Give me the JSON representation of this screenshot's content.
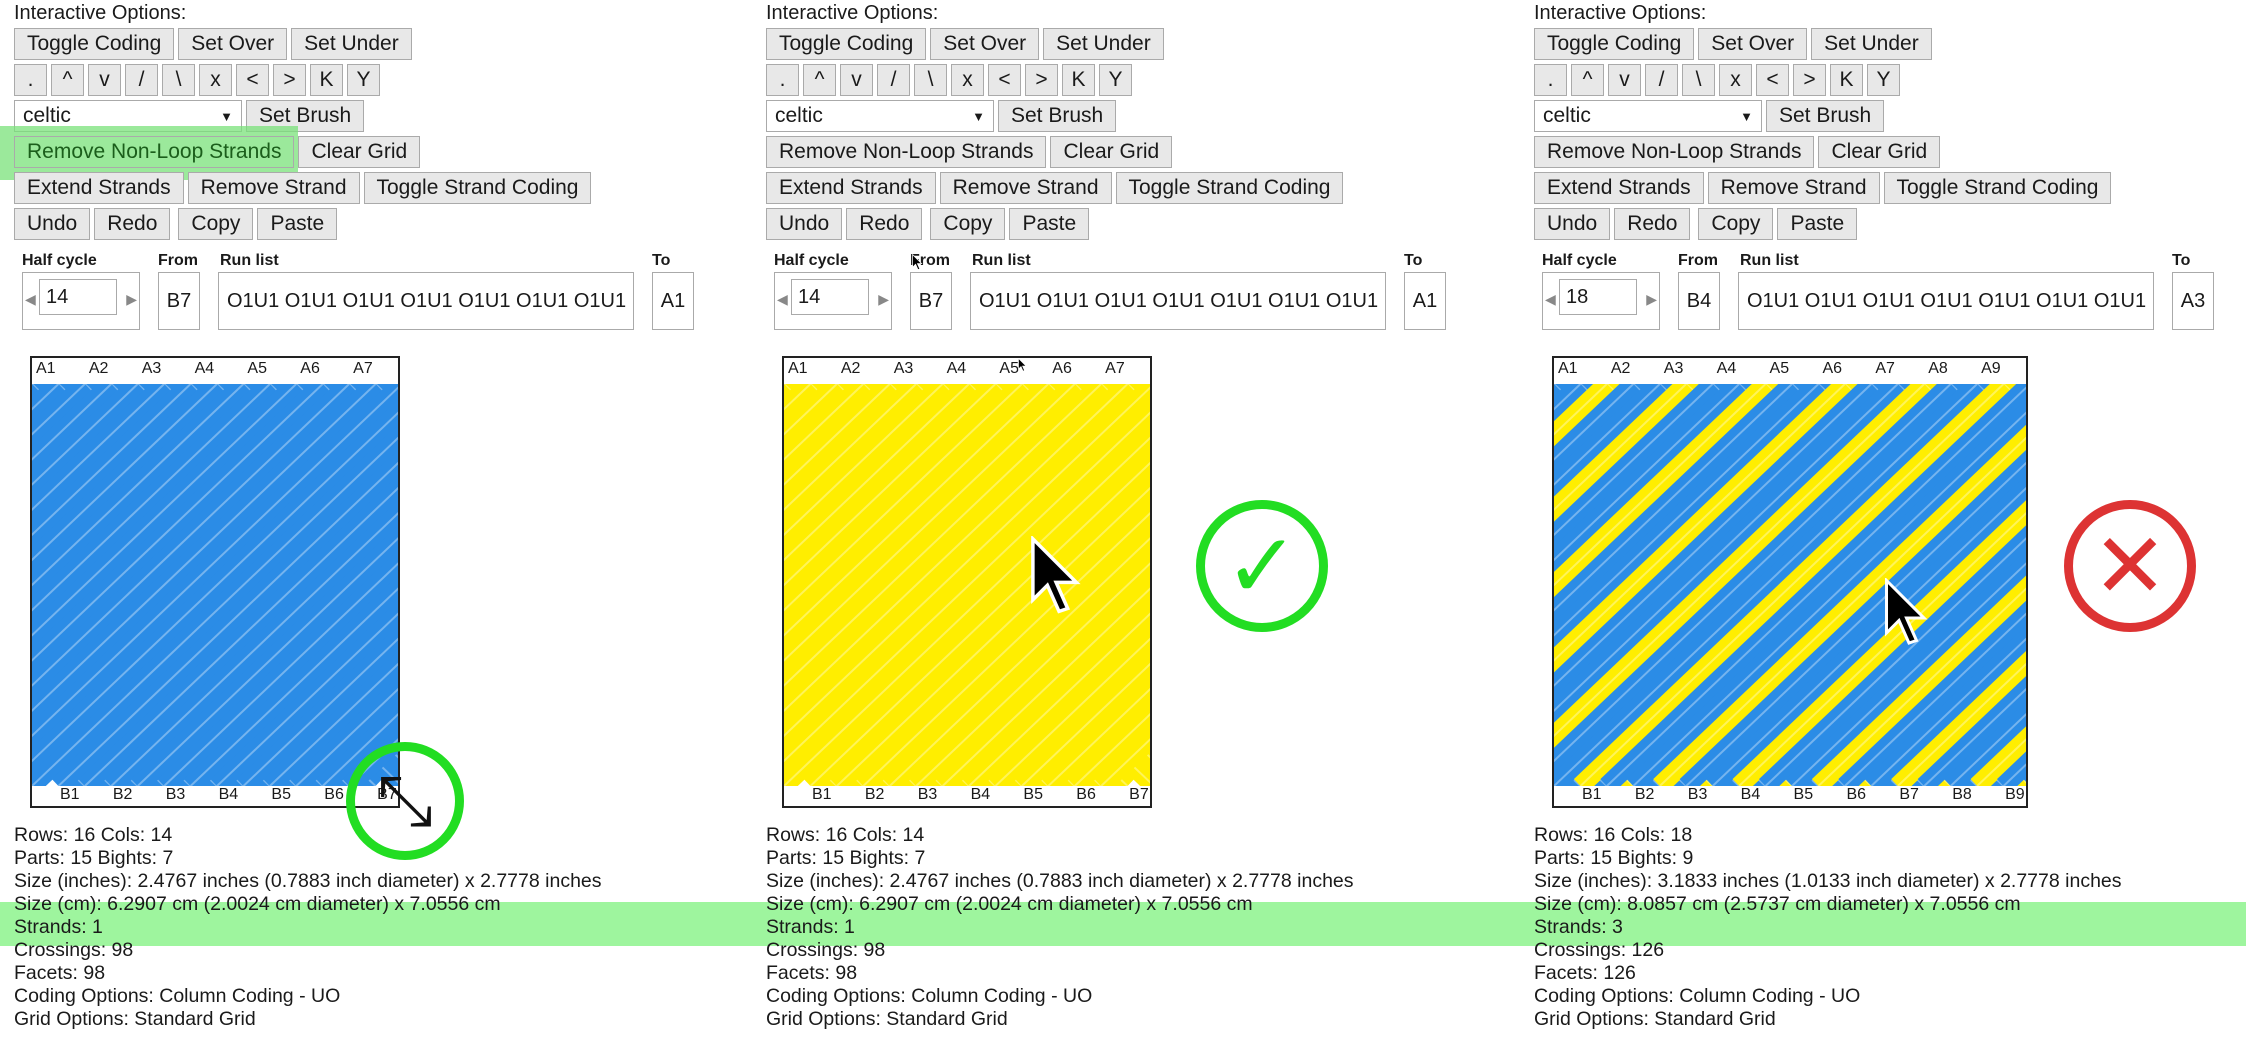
{
  "panels": [
    {
      "interactive_title": "Interactive Options:",
      "toolbar1": [
        "Toggle Coding",
        "Set Over",
        "Set Under"
      ],
      "toolbar2": [
        ".",
        "^",
        "v",
        "/",
        "\\",
        "x",
        "<",
        ">",
        "K",
        "Y"
      ],
      "brush_select": "celtic",
      "set_brush": "Set Brush",
      "toolbar4": [
        "Remove Non-Loop Strands",
        "Clear Grid"
      ],
      "toolbar5": [
        "Extend Strands",
        "Remove Strand",
        "Toggle Strand Coding"
      ],
      "toolbar6": [
        "Undo",
        "Redo",
        "Copy",
        "Paste"
      ],
      "half_cycle_label": "Half cycle",
      "half_cycle_value": "14",
      "from_label": "From",
      "from_value": "B7",
      "run_list_label": "Run list",
      "run_list_value": "O1U1 O1U1 O1U1 O1U1 O1U1 O1U1 O1U1",
      "to_label": "To",
      "to_value": "A1",
      "top_labels": [
        "A1",
        "A2",
        "A3",
        "A4",
        "A5",
        "A6",
        "A7"
      ],
      "bottom_labels": [
        "B1",
        "B2",
        "B3",
        "B4",
        "B5",
        "B6",
        "B7"
      ],
      "strand_colors": [
        "#2b8ce6"
      ],
      "info": [
        "Rows: 16 Cols: 14",
        "Parts: 15 Bights: 7",
        "Size (inches): 2.4767 inches (0.7883 inch diameter) x 2.7778 inches",
        "Size (cm): 6.2907 cm (2.0024 cm diameter) x 7.0556 cm",
        "Strands: 1",
        "Crossings: 98",
        "Facets: 98",
        "Coding Options: Column Coding - UO",
        "Grid Options: Standard Grid"
      ],
      "badge": "resize-icon"
    },
    {
      "interactive_title": "Interactive Options:",
      "toolbar1": [
        "Toggle Coding",
        "Set Over",
        "Set Under"
      ],
      "toolbar2": [
        ".",
        "^",
        "v",
        "/",
        "\\",
        "x",
        "<",
        ">",
        "K",
        "Y"
      ],
      "brush_select": "celtic",
      "set_brush": "Set Brush",
      "toolbar4": [
        "Remove Non-Loop Strands",
        "Clear Grid"
      ],
      "toolbar5": [
        "Extend Strands",
        "Remove Strand",
        "Toggle Strand Coding"
      ],
      "toolbar6": [
        "Undo",
        "Redo",
        "Copy",
        "Paste"
      ],
      "half_cycle_label": "Half cycle",
      "half_cycle_value": "14",
      "from_label": "From",
      "from_value": "B7",
      "run_list_label": "Run list",
      "run_list_value": "O1U1 O1U1 O1U1 O1U1 O1U1 O1U1 O1U1",
      "to_label": "To",
      "to_value": "A1",
      "top_labels": [
        "A1",
        "A2",
        "A3",
        "A4",
        "A5",
        "A6",
        "A7"
      ],
      "bottom_labels": [
        "B1",
        "B2",
        "B3",
        "B4",
        "B5",
        "B6",
        "B7"
      ],
      "strand_colors": [
        "#ffee00"
      ],
      "info": [
        "Rows: 16 Cols: 14",
        "Parts: 15 Bights: 7",
        "Size (inches): 2.4767 inches (0.7883 inch diameter) x 2.7778 inches",
        "Size (cm): 6.2907 cm (2.0024 cm diameter) x 7.0556 cm",
        "Strands: 1",
        "Crossings: 98",
        "Facets: 98",
        "Coding Options: Column Coding - UO",
        "Grid Options: Standard Grid"
      ],
      "badge": "checkmark-icon"
    },
    {
      "interactive_title": "Interactive Options:",
      "toolbar1": [
        "Toggle Coding",
        "Set Over",
        "Set Under"
      ],
      "toolbar2": [
        ".",
        "^",
        "v",
        "/",
        "\\",
        "x",
        "<",
        ">",
        "K",
        "Y"
      ],
      "brush_select": "celtic",
      "set_brush": "Set Brush",
      "toolbar4": [
        "Remove Non-Loop Strands",
        "Clear Grid"
      ],
      "toolbar5": [
        "Extend Strands",
        "Remove Strand",
        "Toggle Strand Coding"
      ],
      "toolbar6": [
        "Undo",
        "Redo",
        "Copy",
        "Paste"
      ],
      "half_cycle_label": "Half cycle",
      "half_cycle_value": "18",
      "from_label": "From",
      "from_value": "B4",
      "run_list_label": "Run list",
      "run_list_value": "O1U1 O1U1 O1U1 O1U1 O1U1 O1U1 O1U1",
      "to_label": "To",
      "to_value": "A3",
      "top_labels": [
        "A1",
        "A2",
        "A3",
        "A4",
        "A5",
        "A6",
        "A7",
        "A8",
        "A9"
      ],
      "bottom_labels": [
        "B1",
        "B2",
        "B3",
        "B4",
        "B5",
        "B6",
        "B7",
        "B8",
        "B9"
      ],
      "strand_colors": [
        "#2b8ce6",
        "#ffee00"
      ],
      "info": [
        "Rows: 16 Cols: 18",
        "Parts: 15 Bights: 9",
        "Size (inches): 3.1833 inches (1.0133 inch diameter) x 2.7778 inches",
        "Size (cm): 8.0857 cm (2.5737 cm diameter) x 7.0556 cm",
        "Strands: 3",
        "Crossings: 126",
        "Facets: 126",
        "Coding Options: Column Coding - UO",
        "Grid Options: Standard Grid"
      ],
      "badge": "cross-icon"
    }
  ],
  "colors": {
    "highlight_green": "#7ae17a",
    "strip_green": "#9ef59e",
    "ok_green": "#22dd22",
    "bad_red": "#dd3333"
  }
}
